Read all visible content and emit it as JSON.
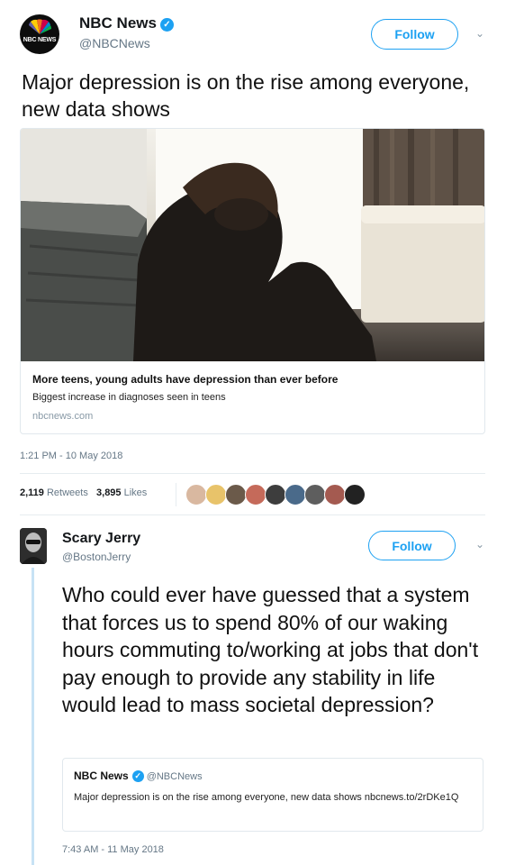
{
  "tweet": {
    "author": {
      "name": "NBC News",
      "handle": "@NBCNews",
      "logo_text": "NBC NEWS"
    },
    "follow_label": "Follow",
    "text": "Major depression is on the rise among everyone, new data shows",
    "card": {
      "title": "More teens, young adults have depression than ever before",
      "subtitle": "Biggest increase in diagnoses seen in teens",
      "domain": "nbcnews.com"
    },
    "timestamp": "1:21 PM - 10 May 2018",
    "retweets_count": "2,119",
    "retweets_label": "Retweets",
    "likes_count": "3,895",
    "likes_label": "Likes"
  },
  "reply": {
    "author": {
      "name": "Scary Jerry",
      "handle": "@BostonJerry"
    },
    "follow_label": "Follow",
    "text": "Who could ever have guessed that a system that forces us to spend 80% of our waking hours commuting to/working at jobs that don't pay enough to provide any stability in life would lead to mass societal depression?",
    "quoted": {
      "name": "NBC News",
      "handle": "@NBCNews",
      "text": "Major depression is on the rise among everyone, new data shows nbcnews.to/2rDKe1Q"
    },
    "timestamp": "7:43 AM - 11 May 2018"
  },
  "colors": {
    "accent": "#1da1f2",
    "muted": "#657786",
    "thread": "#c7e2f5"
  },
  "icons": [
    "verified-badge-icon",
    "chevron-down-icon",
    "peacock-logo-icon"
  ]
}
